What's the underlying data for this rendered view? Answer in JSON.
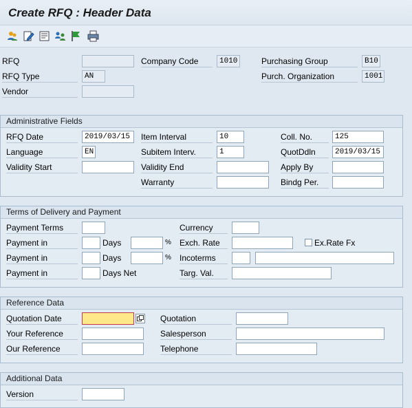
{
  "title": "Create RFQ : Header Data",
  "toolbar": {
    "icons": [
      "partners-icon",
      "edit-icon",
      "texts-icon",
      "contacts-icon",
      "status-flag-icon",
      "print-icon"
    ]
  },
  "header": {
    "rfq_label": "RFQ",
    "rfq_value": "",
    "company_code_label": "Company Code",
    "company_code_value": "1010",
    "purch_group_label": "Purchasing Group",
    "purch_group_value": "B10",
    "rfq_type_label": "RFQ Type",
    "rfq_type_value": "AN",
    "purch_org_label": "Purch. Organization",
    "purch_org_value": "1001",
    "vendor_label": "Vendor",
    "vendor_value": ""
  },
  "admin": {
    "title": "Administrative Fields",
    "rfq_date_label": "RFQ Date",
    "rfq_date_value": "2019/03/15",
    "item_interval_label": "Item Interval",
    "item_interval_value": "10",
    "coll_no_label": "Coll. No.",
    "coll_no_value": "125",
    "language_label": "Language",
    "language_value": "EN",
    "subitem_label": "Subitem Interv.",
    "subitem_value": "1",
    "quotddln_label": "QuotDdln",
    "quotddln_value": "2019/03/15",
    "validity_start_label": "Validity Start",
    "validity_start_value": "",
    "validity_end_label": "Validity End",
    "validity_end_value": "",
    "apply_by_label": "Apply By",
    "apply_by_value": "",
    "warranty_label": "Warranty",
    "warranty_value": "",
    "bindg_label": "Bindg Per.",
    "bindg_value": ""
  },
  "terms": {
    "title": "Terms of Delivery and Payment",
    "payment_terms_label": "Payment Terms",
    "currency_label": "Currency",
    "payment_in_label": "Payment in",
    "days_label": "Days",
    "percent": "%",
    "exch_rate_label": "Exch. Rate",
    "exrate_fx_label": "Ex.Rate Fx",
    "incoterms_label": "Incoterms",
    "days_net_label": "Days Net",
    "targ_val_label": "Targ. Val."
  },
  "reference": {
    "title": "Reference Data",
    "quotation_date_label": "Quotation Date",
    "quotation_label": "Quotation",
    "your_reference_label": "Your Reference",
    "salesperson_label": "Salesperson",
    "our_reference_label": "Our Reference",
    "telephone_label": "Telephone"
  },
  "additional": {
    "title": "Additional Data",
    "version_label": "Version"
  }
}
